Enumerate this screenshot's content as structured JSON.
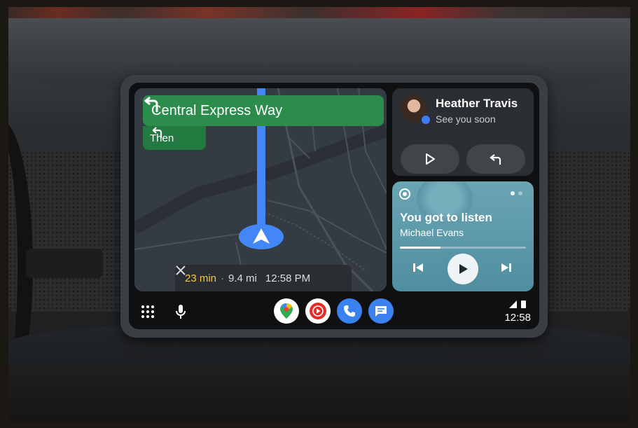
{
  "navigation": {
    "next_street": "Central Express Way",
    "then_label": "Then",
    "eta_minutes": "23 min",
    "separator": "·",
    "distance": "9.4 mi",
    "arrival_time": "12:58 PM"
  },
  "message": {
    "sender": "Heather Travis",
    "preview": "See you soon"
  },
  "media": {
    "title": "You got to listen",
    "artist": "Michael Evans",
    "progress_fraction": 0.32,
    "page_indicator": {
      "pages": 2,
      "current": 1
    }
  },
  "status": {
    "time": "12:58"
  },
  "apps": [
    "maps-icon",
    "youtube-music-icon",
    "phone-icon",
    "messages-icon"
  ],
  "colors": {
    "nav_green": "#2c8c4c",
    "route_blue": "#4287f5",
    "eta_yellow": "#f6c744",
    "media_teal": "#5c9aaa"
  }
}
